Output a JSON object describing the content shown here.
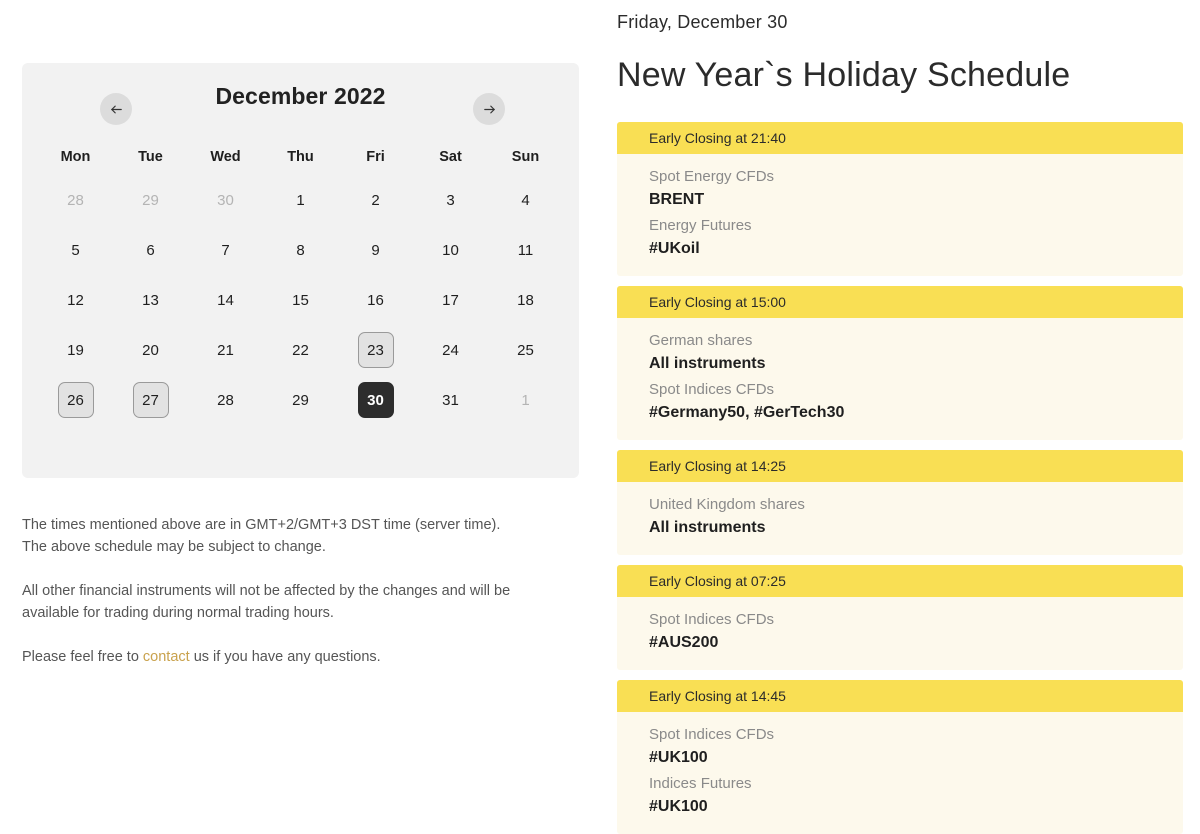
{
  "calendar": {
    "title": "December 2022",
    "prev_icon": "arrow-left-icon",
    "next_icon": "arrow-right-icon",
    "weekdays": [
      "Mon",
      "Tue",
      "Wed",
      "Thu",
      "Fri",
      "Sat",
      "Sun"
    ],
    "days": [
      {
        "label": "28",
        "state": "muted"
      },
      {
        "label": "29",
        "state": "muted"
      },
      {
        "label": "30",
        "state": "muted"
      },
      {
        "label": "1",
        "state": "normal"
      },
      {
        "label": "2",
        "state": "normal"
      },
      {
        "label": "3",
        "state": "normal"
      },
      {
        "label": "4",
        "state": "normal"
      },
      {
        "label": "5",
        "state": "normal"
      },
      {
        "label": "6",
        "state": "normal"
      },
      {
        "label": "7",
        "state": "normal"
      },
      {
        "label": "8",
        "state": "normal"
      },
      {
        "label": "9",
        "state": "normal"
      },
      {
        "label": "10",
        "state": "normal"
      },
      {
        "label": "11",
        "state": "normal"
      },
      {
        "label": "12",
        "state": "normal"
      },
      {
        "label": "13",
        "state": "normal"
      },
      {
        "label": "14",
        "state": "normal"
      },
      {
        "label": "15",
        "state": "normal"
      },
      {
        "label": "16",
        "state": "normal"
      },
      {
        "label": "17",
        "state": "normal"
      },
      {
        "label": "18",
        "state": "normal"
      },
      {
        "label": "19",
        "state": "normal"
      },
      {
        "label": "20",
        "state": "normal"
      },
      {
        "label": "21",
        "state": "normal"
      },
      {
        "label": "22",
        "state": "normal"
      },
      {
        "label": "23",
        "state": "marked"
      },
      {
        "label": "24",
        "state": "normal"
      },
      {
        "label": "25",
        "state": "normal"
      },
      {
        "label": "26",
        "state": "marked"
      },
      {
        "label": "27",
        "state": "marked"
      },
      {
        "label": "28",
        "state": "normal"
      },
      {
        "label": "29",
        "state": "normal"
      },
      {
        "label": "30",
        "state": "selected"
      },
      {
        "label": "31",
        "state": "normal"
      },
      {
        "label": "1",
        "state": "muted"
      }
    ]
  },
  "notes": {
    "line1": "The times mentioned above are in GMT+2/GMT+3 DST time (server time).",
    "line2": "The above schedule may be subject to change.",
    "paragraph2": "All other financial instruments will not be affected by the changes and will be available for trading during normal trading hours.",
    "paragraph3_before": "Please feel free to ",
    "contact_label": "contact",
    "paragraph3_after": " us if you have any questions."
  },
  "schedule": {
    "eyebrow": "Friday, December 30",
    "headline": "New Year`s Holiday Schedule",
    "cards": [
      {
        "time_label": "Early Closing at 21:40",
        "entries": [
          {
            "category": "Spot Energy CFDs",
            "instrument": "BRENT"
          },
          {
            "category": "Energy Futures",
            "instrument": "#UKoil"
          }
        ]
      },
      {
        "time_label": "Early Closing at 15:00",
        "entries": [
          {
            "category": "German shares",
            "instrument": "All instruments"
          },
          {
            "category": "Spot Indices CFDs",
            "instrument": "#Germany50, #GerTech30"
          }
        ]
      },
      {
        "time_label": "Early Closing at 14:25",
        "entries": [
          {
            "category": "United Kingdom shares",
            "instrument": "All instruments"
          }
        ]
      },
      {
        "time_label": "Early Closing at 07:25",
        "entries": [
          {
            "category": "Spot Indices CFDs",
            "instrument": "#AUS200"
          }
        ]
      },
      {
        "time_label": "Early Closing at 14:45",
        "entries": [
          {
            "category": "Spot Indices CFDs",
            "instrument": "#UK100"
          },
          {
            "category": "Indices Futures",
            "instrument": "#UK100"
          }
        ]
      }
    ]
  },
  "colors": {
    "accent_yellow": "#f9df54",
    "card_body": "#fdf9ec",
    "panel_gray": "#f2f2f2",
    "selected_day": "#2d2d2d",
    "link": "#c9a24d"
  }
}
